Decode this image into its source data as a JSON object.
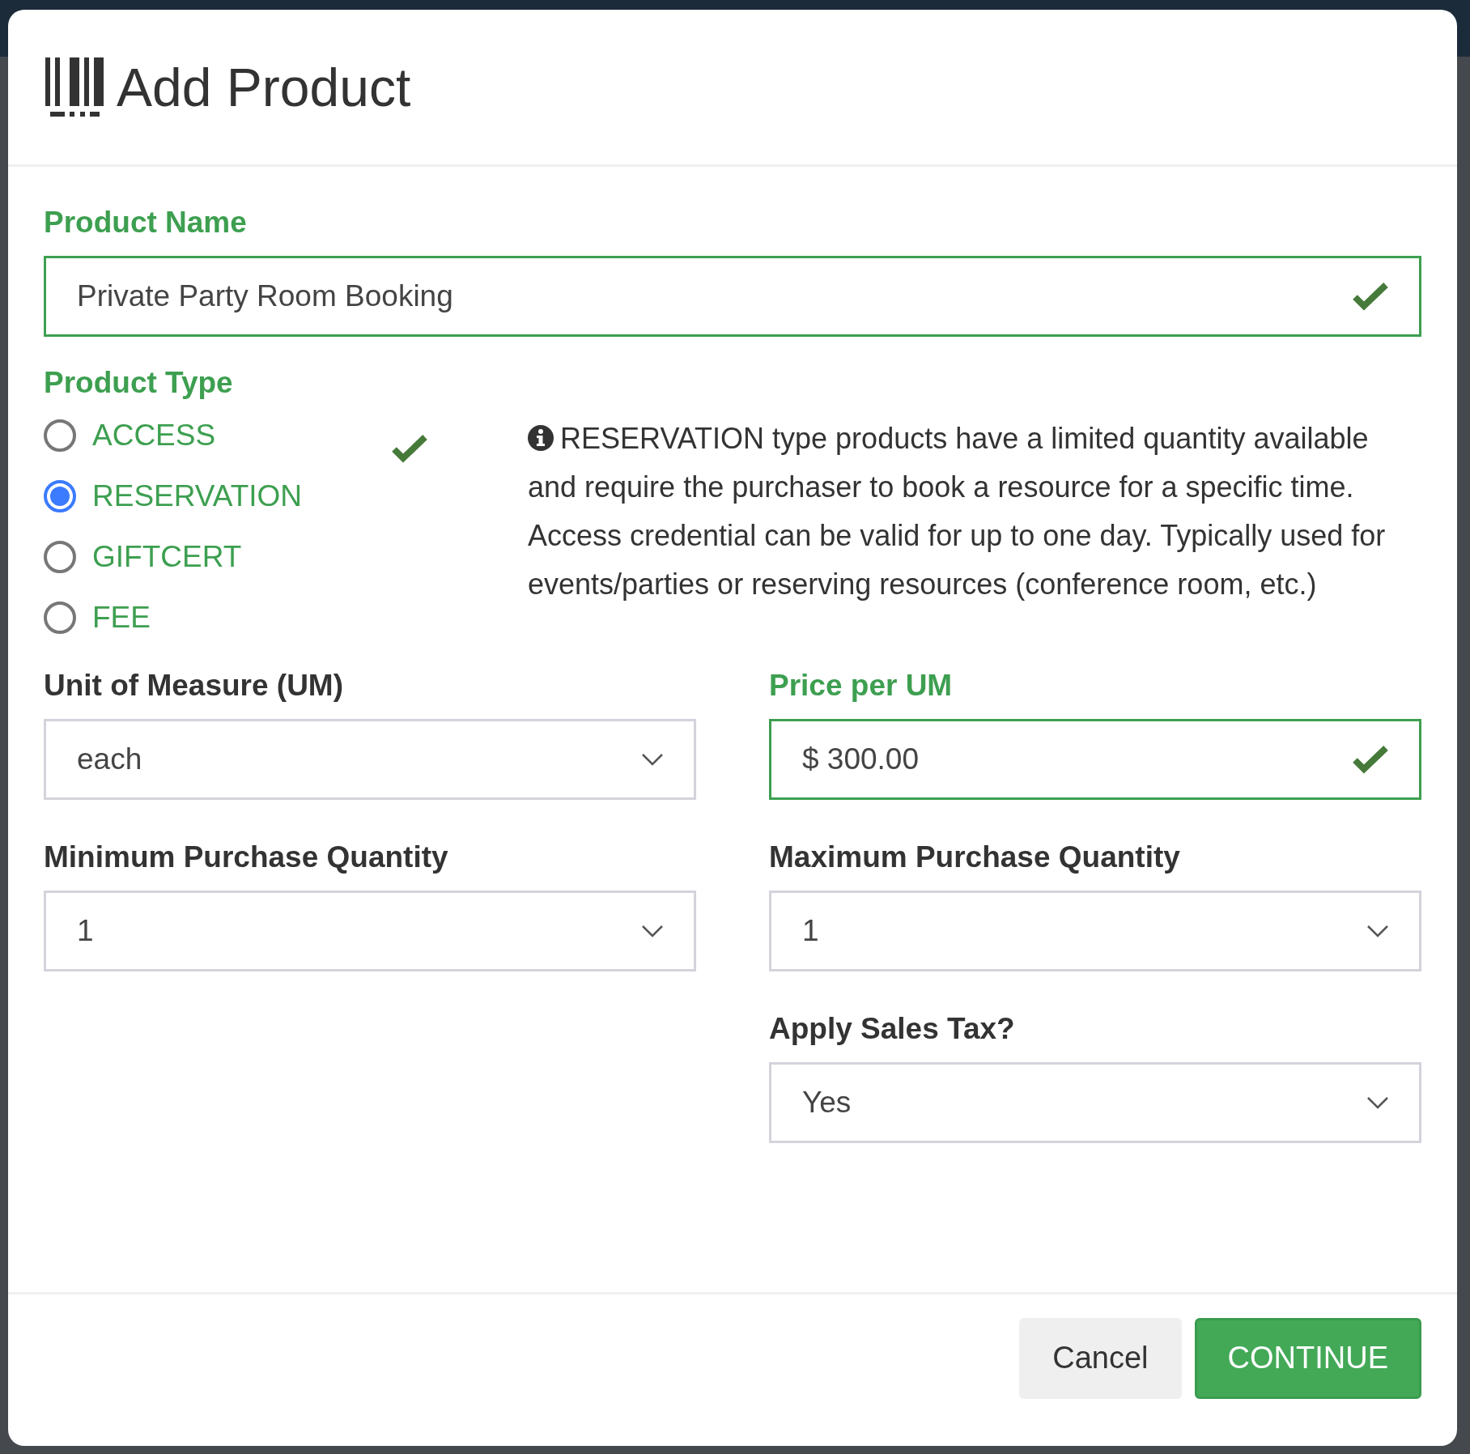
{
  "dialog": {
    "title": "Add Product"
  },
  "product_name": {
    "label": "Product Name",
    "value": "Private Party Room Booking",
    "valid": true
  },
  "product_type": {
    "label": "Product Type",
    "valid": true,
    "options": [
      {
        "label": "ACCESS",
        "selected": false
      },
      {
        "label": "RESERVATION",
        "selected": true
      },
      {
        "label": "GIFTCERT",
        "selected": false
      },
      {
        "label": "FEE",
        "selected": false
      }
    ],
    "info": "RESERVATION type products have a limited quantity available and require the purchaser to book a resource for a specific time. Access credential can be valid for up to one day. Typically used for events/parties or reserving resources (conference room, etc.)"
  },
  "fields": [
    {
      "label": "Unit of Measure (UM)",
      "kind": "select",
      "value": "each",
      "valid": false
    },
    {
      "label": "Price per UM",
      "kind": "text",
      "value": "$ 300.00",
      "valid": true
    },
    {
      "label": "Minimum Purchase Quantity",
      "kind": "select",
      "value": "1",
      "valid": false
    },
    {
      "label": "Maximum Purchase Quantity",
      "kind": "select",
      "value": "1",
      "valid": false
    },
    {
      "label": "Apply Sales Tax?",
      "kind": "select",
      "value": "Yes",
      "valid": false
    }
  ],
  "buttons": [
    {
      "label": "Cancel",
      "kind": "secondary"
    },
    {
      "label": "CONTINUE",
      "kind": "primary"
    }
  ]
}
